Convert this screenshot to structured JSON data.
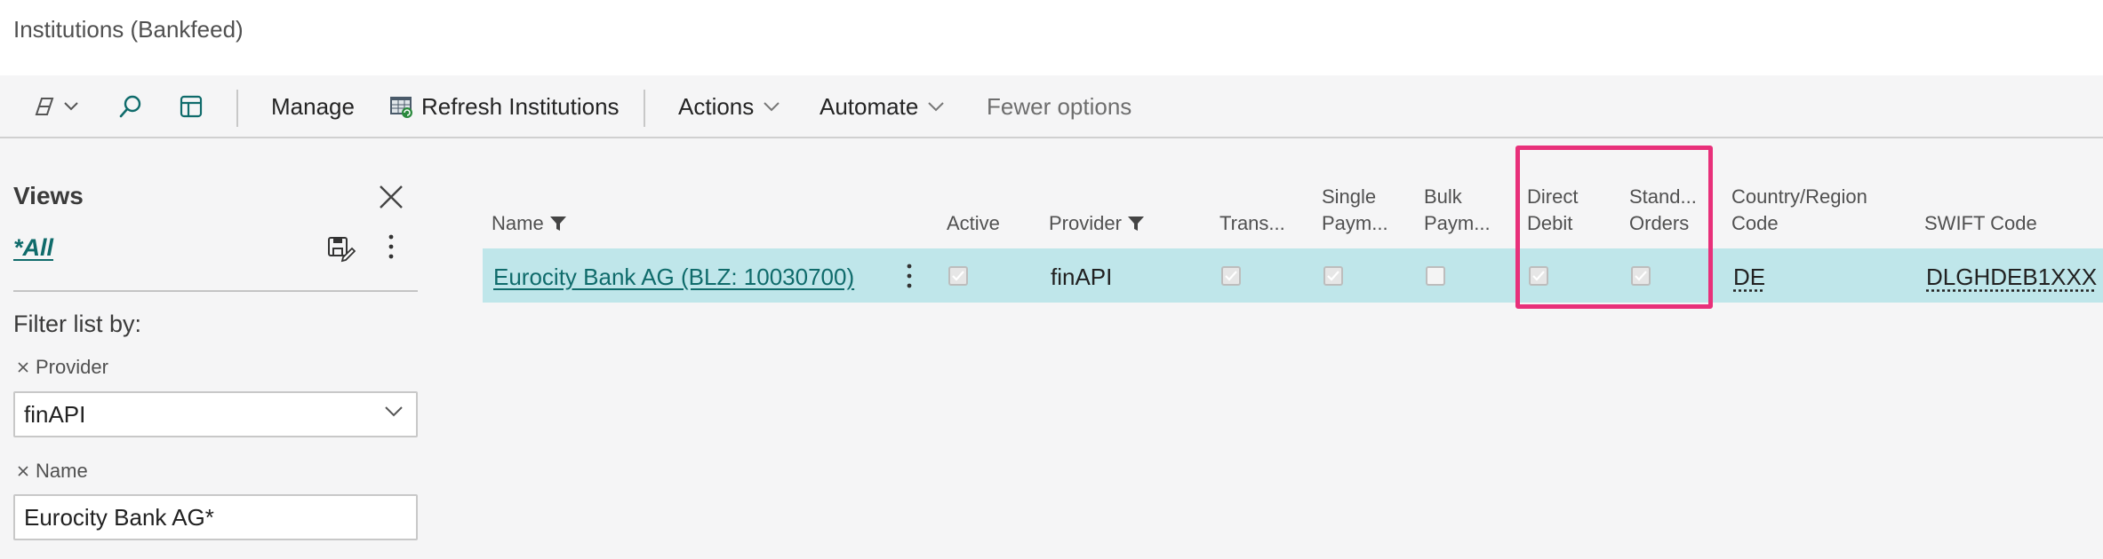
{
  "page": {
    "title": "Institutions (Bankfeed)"
  },
  "actionbar": {
    "manage": "Manage",
    "refresh": "Refresh Institutions",
    "actions": "Actions",
    "automate": "Automate",
    "fewer": "Fewer options"
  },
  "views": {
    "title": "Views",
    "all": "*All",
    "filter_label": "Filter list by:",
    "filters": [
      {
        "name": "Provider",
        "value": "finAPI"
      },
      {
        "name": "Name",
        "value": "Eurocity Bank AG*"
      }
    ]
  },
  "grid": {
    "columns": {
      "name": "Name",
      "active": "Active",
      "provider": "Provider",
      "trans": "Trans...",
      "single_1": "Single",
      "single_2": "Paym...",
      "bulk_1": "Bulk",
      "bulk_2": "Paym...",
      "direct_1": "Direct",
      "direct_2": "Debit",
      "stand_1": "Stand...",
      "stand_2": "Orders",
      "country_1": "Country/Region",
      "country_2": "Code",
      "swift": "SWIFT Code"
    },
    "rows": [
      {
        "name": "Eurocity Bank AG (BLZ: 10030700)",
        "active": true,
        "provider": "finAPI",
        "trans": true,
        "single": true,
        "bulk": false,
        "direct": true,
        "stand": true,
        "country": "DE",
        "swift": "DLGHDEB1XXX"
      }
    ]
  },
  "colors": {
    "accent": "#0f6b6b",
    "row_selected": "#bfe6ea",
    "highlight": "#e8307a"
  }
}
